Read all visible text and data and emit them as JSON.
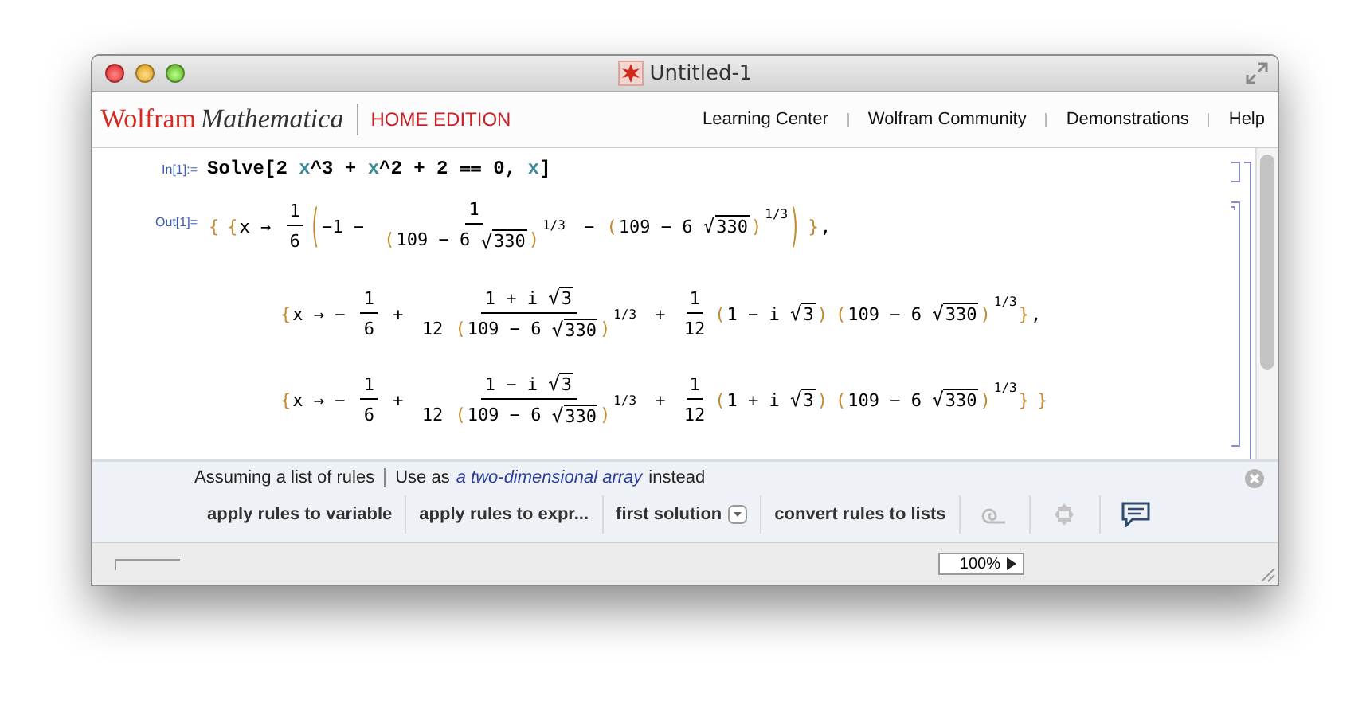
{
  "window": {
    "title": "Untitled-1"
  },
  "header": {
    "brand": "Wolfram",
    "product": "Mathematica",
    "edition": "HOME EDITION",
    "links": [
      "Learning Center",
      "Wolfram Community",
      "Demonstrations",
      "Help"
    ]
  },
  "input_cell": {
    "label": "In[1]:=",
    "tokens": [
      {
        "kind": "t",
        "text": "Solve[2 "
      },
      {
        "kind": "var",
        "text": "x"
      },
      {
        "kind": "t",
        "text": "^3 + "
      },
      {
        "kind": "var",
        "text": "x"
      },
      {
        "kind": "t",
        "text": "^2 + 2 ⩵ 0, "
      },
      {
        "kind": "var",
        "text": "x"
      },
      {
        "kind": "t",
        "text": "]"
      }
    ]
  },
  "output_cell": {
    "label": "Out[1]=",
    "lines": [
      [
        {
          "kind": "b",
          "text": "{"
        },
        {
          "kind": "b",
          "text": "{"
        },
        {
          "kind": "t",
          "text": "x → "
        },
        {
          "kind": "frac",
          "num": [
            {
              "kind": "t",
              "text": "1"
            }
          ],
          "den": [
            {
              "kind": "t",
              "text": "6"
            }
          ]
        },
        {
          "kind": "bigb",
          "text": "("
        },
        {
          "kind": "t",
          "text": "−1 − "
        },
        {
          "kind": "frac",
          "num": [
            {
              "kind": "t",
              "text": "1"
            }
          ],
          "den": [
            {
              "kind": "b",
              "text": "("
            },
            {
              "kind": "t",
              "text": "109 − 6 "
            },
            {
              "kind": "sqrt",
              "sign": "√",
              "text": "330"
            },
            {
              "kind": "b",
              "text": ")"
            },
            {
              "kind": "sup",
              "text": "1/3"
            }
          ]
        },
        {
          "kind": "t",
          "text": " − "
        },
        {
          "kind": "b",
          "text": "("
        },
        {
          "kind": "t",
          "text": "109 − 6 "
        },
        {
          "kind": "sqrt",
          "sign": "√",
          "text": "330"
        },
        {
          "kind": "b",
          "text": ")"
        },
        {
          "kind": "sup",
          "text": "1/3"
        },
        {
          "kind": "bigb",
          "text": ")"
        },
        {
          "kind": "b",
          "text": "}"
        },
        {
          "kind": "t",
          "text": ","
        }
      ],
      [
        {
          "kind": "b",
          "text": "{"
        },
        {
          "kind": "t",
          "text": "x → − "
        },
        {
          "kind": "frac",
          "num": [
            {
              "kind": "t",
              "text": "1"
            }
          ],
          "den": [
            {
              "kind": "t",
              "text": "6"
            }
          ]
        },
        {
          "kind": "t",
          "text": " + "
        },
        {
          "kind": "frac",
          "num": [
            {
              "kind": "t",
              "text": "1 + i "
            },
            {
              "kind": "sqrt",
              "sign": "√",
              "text": "3"
            }
          ],
          "den": [
            {
              "kind": "t",
              "text": "12 "
            },
            {
              "kind": "b",
              "text": "("
            },
            {
              "kind": "t",
              "text": "109 − 6 "
            },
            {
              "kind": "sqrt",
              "sign": "√",
              "text": "330"
            },
            {
              "kind": "b",
              "text": ")"
            },
            {
              "kind": "sup",
              "text": "1/3"
            }
          ]
        },
        {
          "kind": "t",
          "text": " + "
        },
        {
          "kind": "frac",
          "num": [
            {
              "kind": "t",
              "text": "1"
            }
          ],
          "den": [
            {
              "kind": "t",
              "text": "12"
            }
          ]
        },
        {
          "kind": "b",
          "text": "("
        },
        {
          "kind": "t",
          "text": "1 − i "
        },
        {
          "kind": "sqrt",
          "sign": "√",
          "text": "3"
        },
        {
          "kind": "b",
          "text": ")"
        },
        {
          "kind": "b",
          "text": "("
        },
        {
          "kind": "t",
          "text": "109 − 6 "
        },
        {
          "kind": "sqrt",
          "sign": "√",
          "text": "330"
        },
        {
          "kind": "b",
          "text": ")"
        },
        {
          "kind": "sup",
          "text": "1/3"
        },
        {
          "kind": "b",
          "text": "}"
        },
        {
          "kind": "t",
          "text": ","
        }
      ],
      [
        {
          "kind": "b",
          "text": "{"
        },
        {
          "kind": "t",
          "text": "x → − "
        },
        {
          "kind": "frac",
          "num": [
            {
              "kind": "t",
              "text": "1"
            }
          ],
          "den": [
            {
              "kind": "t",
              "text": "6"
            }
          ]
        },
        {
          "kind": "t",
          "text": " + "
        },
        {
          "kind": "frac",
          "num": [
            {
              "kind": "t",
              "text": "1 − i "
            },
            {
              "kind": "sqrt",
              "sign": "√",
              "text": "3"
            }
          ],
          "den": [
            {
              "kind": "t",
              "text": "12 "
            },
            {
              "kind": "b",
              "text": "("
            },
            {
              "kind": "t",
              "text": "109 − 6 "
            },
            {
              "kind": "sqrt",
              "sign": "√",
              "text": "330"
            },
            {
              "kind": "b",
              "text": ")"
            },
            {
              "kind": "sup",
              "text": "1/3"
            }
          ]
        },
        {
          "kind": "t",
          "text": " + "
        },
        {
          "kind": "frac",
          "num": [
            {
              "kind": "t",
              "text": "1"
            }
          ],
          "den": [
            {
              "kind": "t",
              "text": "12"
            }
          ]
        },
        {
          "kind": "b",
          "text": "("
        },
        {
          "kind": "t",
          "text": "1 + i "
        },
        {
          "kind": "sqrt",
          "sign": "√",
          "text": "3"
        },
        {
          "kind": "b",
          "text": ")"
        },
        {
          "kind": "b",
          "text": "("
        },
        {
          "kind": "t",
          "text": "109 − 6 "
        },
        {
          "kind": "sqrt",
          "sign": "√",
          "text": "330"
        },
        {
          "kind": "b",
          "text": ")"
        },
        {
          "kind": "sup",
          "text": "1/3"
        },
        {
          "kind": "b",
          "text": "}"
        },
        {
          "kind": "b",
          "text": "}"
        }
      ]
    ]
  },
  "suggestions": {
    "assumption": "Assuming a list of rules",
    "use_as": "Use as",
    "link": "a two-dimensional array",
    "after": "instead",
    "buttons": [
      {
        "kind": "text",
        "label": "apply rules to variable"
      },
      {
        "kind": "text",
        "label": "apply rules to expr..."
      },
      {
        "kind": "dropdown",
        "label": "first solution"
      },
      {
        "kind": "text",
        "label": "convert rules to lists"
      }
    ]
  },
  "status_bar": {
    "zoom": "100%"
  }
}
